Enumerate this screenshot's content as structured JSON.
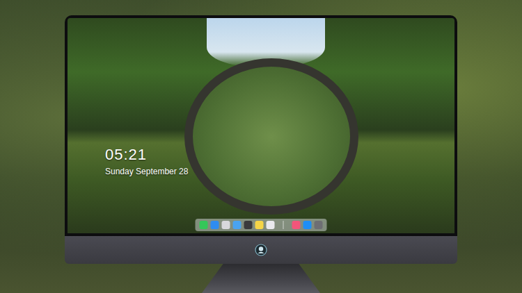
{
  "lock_screen": {
    "time": "05:21",
    "date": "Sunday September 28"
  },
  "dock": {
    "apps": [
      {
        "color": "#34c759"
      },
      {
        "color": "#2f8cf0"
      },
      {
        "color": "#d8d8dc"
      },
      {
        "color": "#4aa3f0"
      },
      {
        "color": "#3a3a3c"
      },
      {
        "color": "#f5d547"
      },
      {
        "color": "#e9e9ee"
      }
    ],
    "extras": [
      {
        "color": "#f2557a"
      },
      {
        "color": "#1e8ef5"
      },
      {
        "color": "#6e6e73"
      }
    ]
  }
}
